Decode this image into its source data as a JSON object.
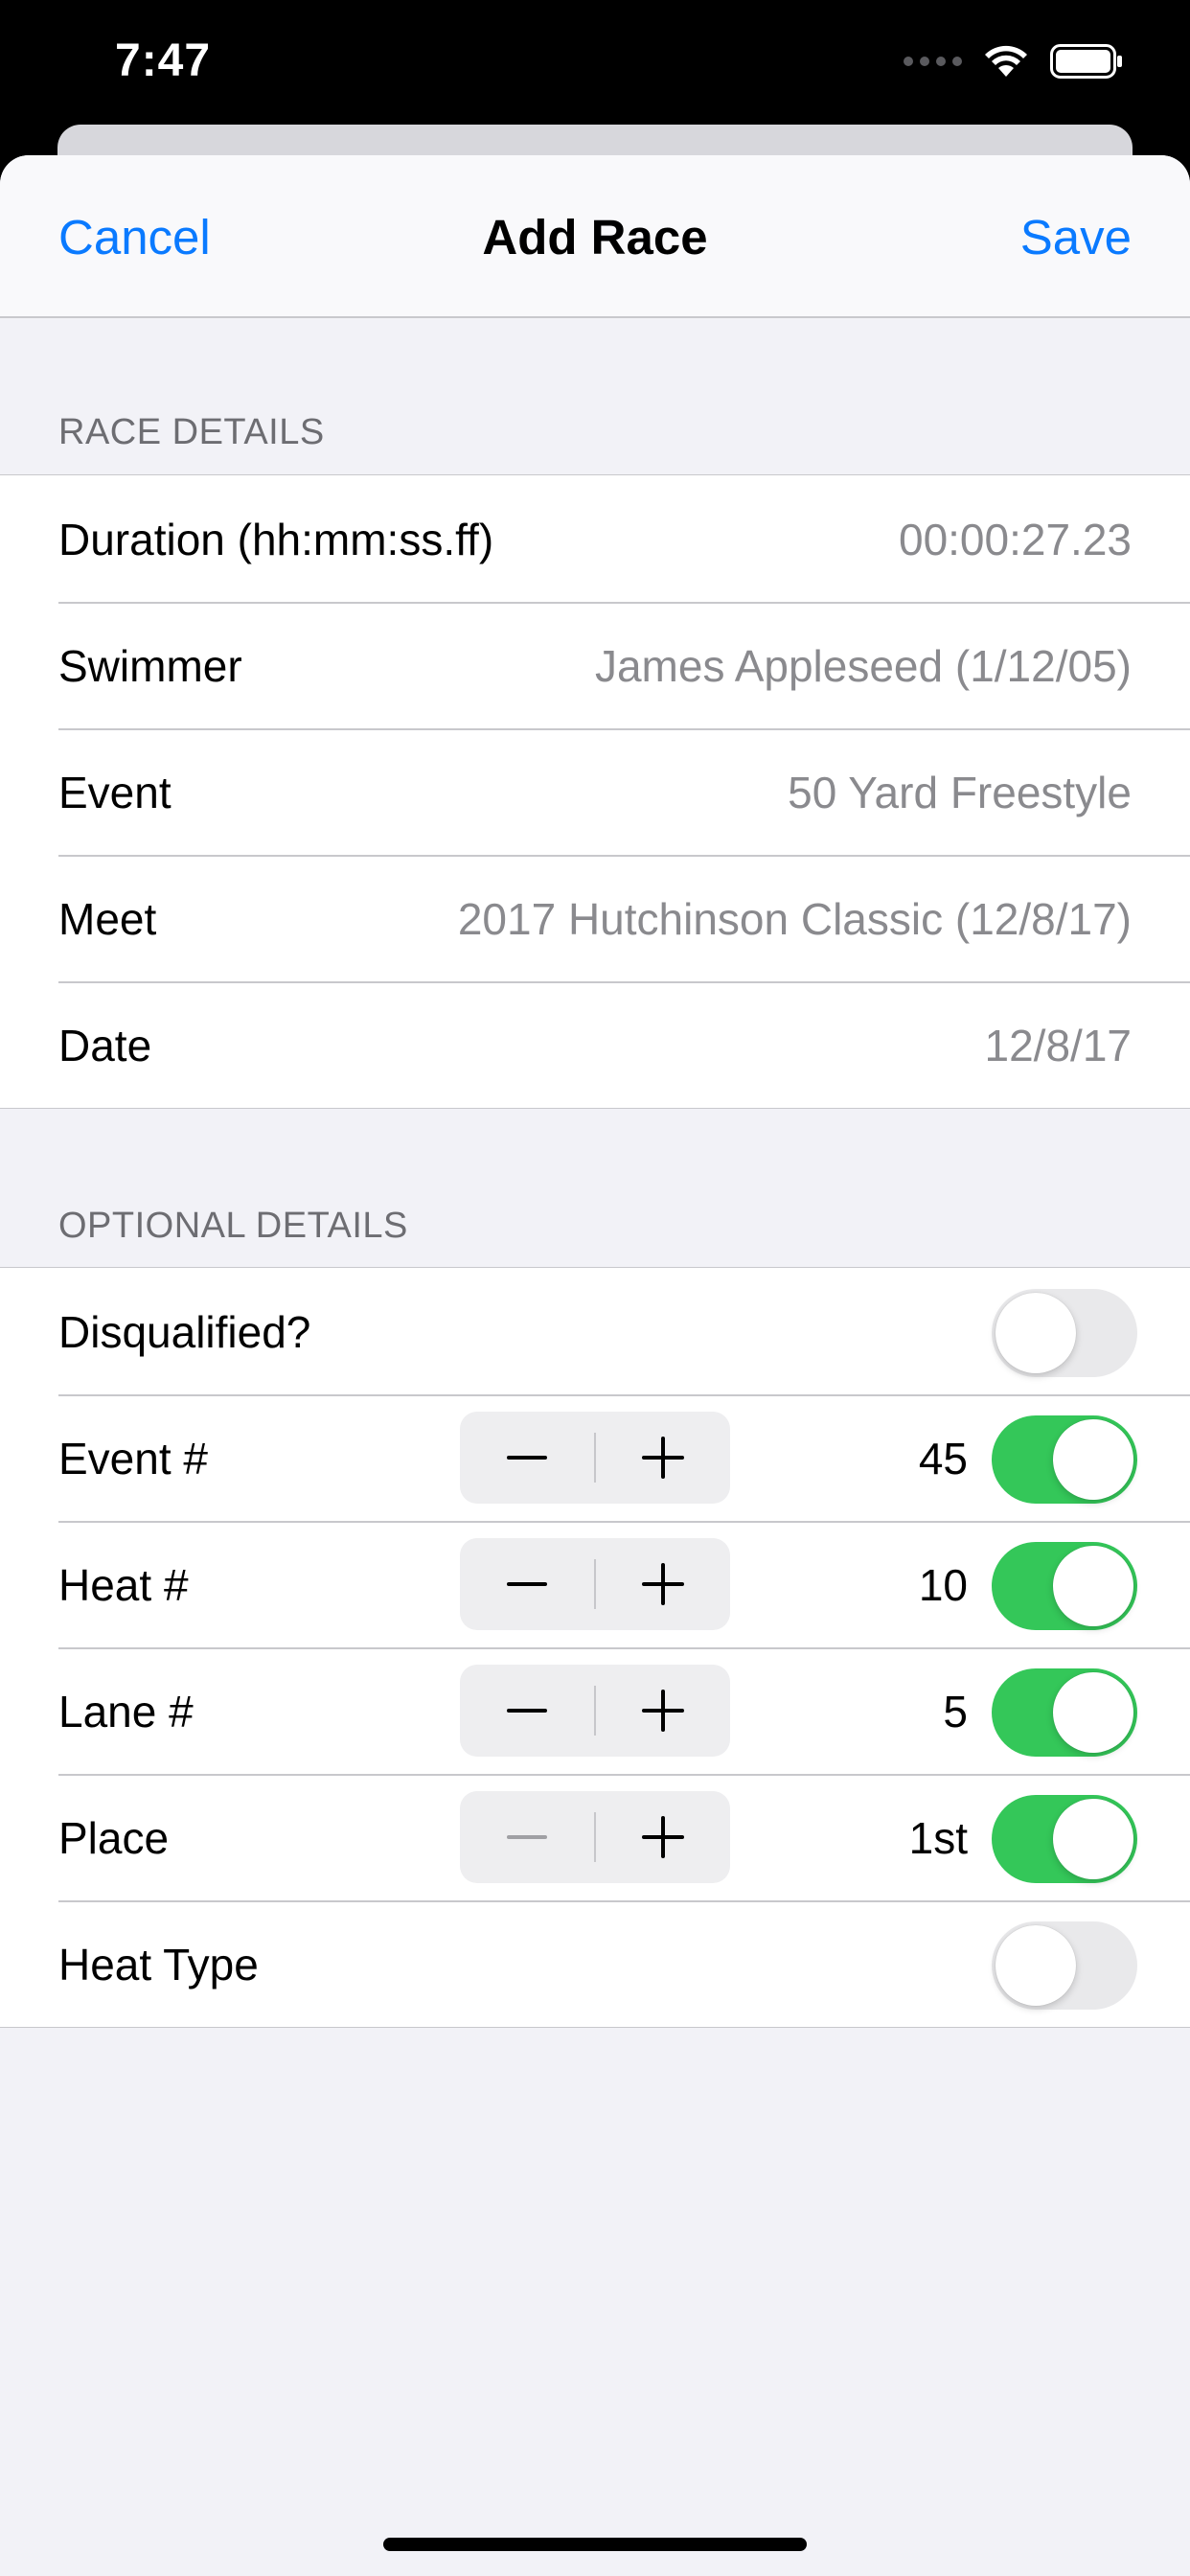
{
  "status_bar": {
    "time": "7:47",
    "icons": [
      "signal-dots-icon",
      "wifi-icon",
      "battery-icon"
    ]
  },
  "nav": {
    "cancel_label": "Cancel",
    "title": "Add Race",
    "save_label": "Save"
  },
  "race_details": {
    "header": "RACE DETAILS",
    "rows": [
      {
        "label": "Duration (hh:mm:ss.ff)",
        "value": "00:00:27.23"
      },
      {
        "label": "Swimmer",
        "value": "James Appleseed (1/12/05)"
      },
      {
        "label": "Event",
        "value": "50 Yard Freestyle"
      },
      {
        "label": "Meet",
        "value": "2017 Hutchinson Classic (12/8/17)"
      },
      {
        "label": "Date",
        "value": "12/8/17"
      }
    ]
  },
  "optional_details": {
    "header": "OPTIONAL DETAILS",
    "rows": [
      {
        "label": "Disqualified?",
        "toggle_on": false
      },
      {
        "label": "Event #",
        "count": "45",
        "toggle_on": true,
        "minus_enabled": true
      },
      {
        "label": "Heat #",
        "count": "10",
        "toggle_on": true,
        "minus_enabled": true
      },
      {
        "label": "Lane #",
        "count": "5",
        "toggle_on": true,
        "minus_enabled": true
      },
      {
        "label": "Place",
        "count": "1st",
        "toggle_on": true,
        "minus_enabled": false
      },
      {
        "label": "Heat Type",
        "toggle_on": false
      }
    ]
  },
  "colors": {
    "accent": "#0a7aff",
    "toggle_on": "#34c759",
    "toggle_off": "#e9e9eb",
    "secondary_text": "#8a8a8e",
    "background": "#f2f2f7"
  }
}
